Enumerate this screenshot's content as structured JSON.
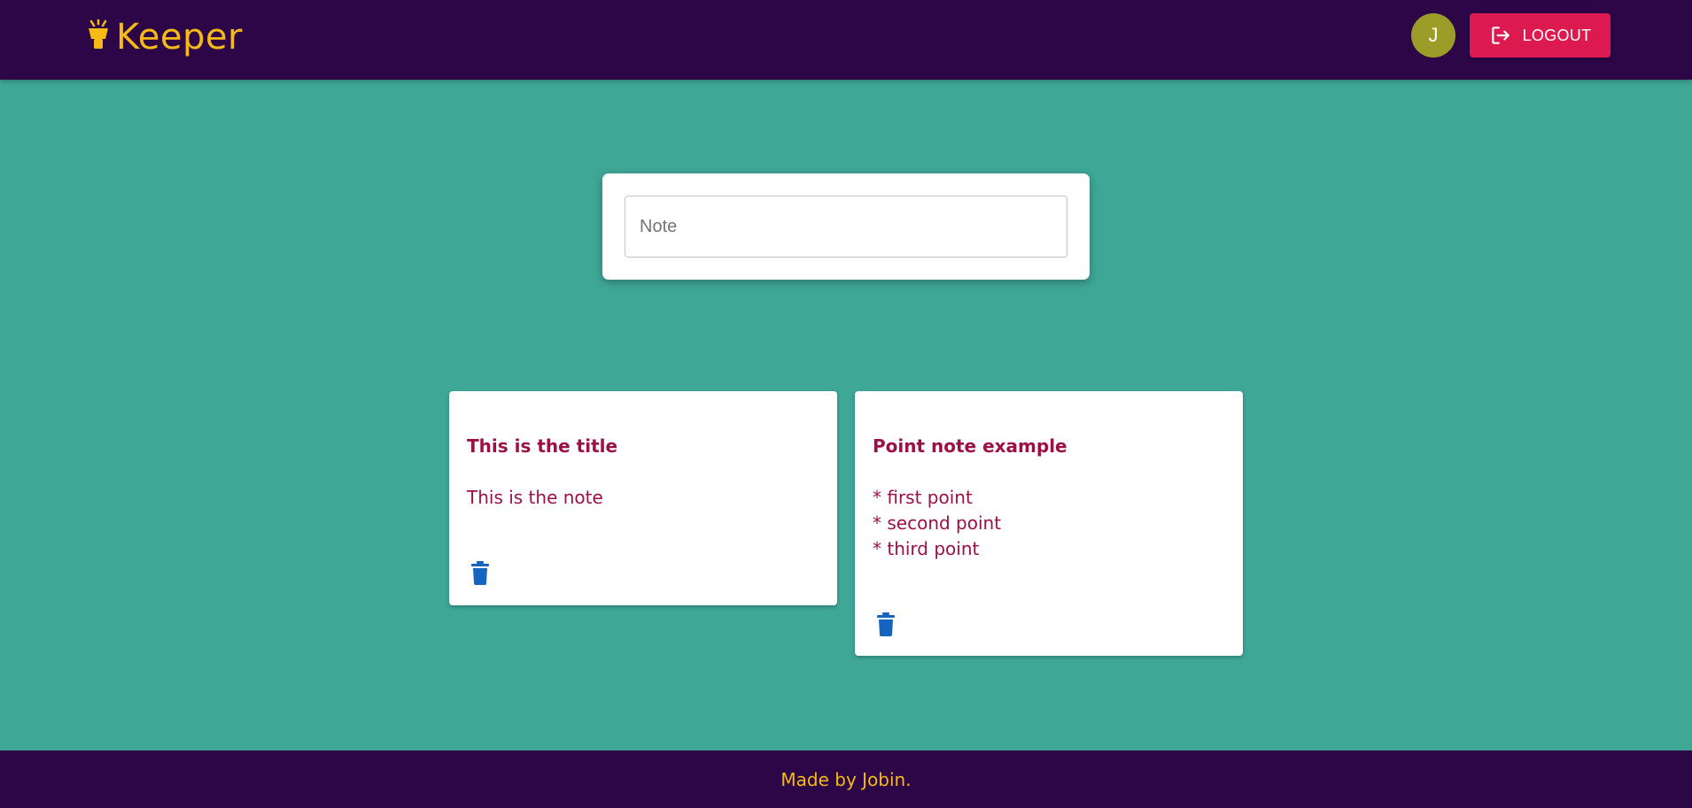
{
  "header": {
    "brand": {
      "name": "Keeper",
      "icon": "lightbulb-icon"
    },
    "avatar": {
      "initial": "J"
    },
    "logout": {
      "label": "LOGOUT",
      "icon": "logout-icon"
    }
  },
  "create_note": {
    "placeholder": "Note",
    "value": ""
  },
  "notes": [
    {
      "title": "This is the title",
      "lines": [
        "This is the note"
      ],
      "delete_icon": "trash-icon"
    },
    {
      "title": "Point note example",
      "lines": [
        "* first point",
        "* second point",
        "* third point"
      ],
      "delete_icon": "trash-icon"
    }
  ],
  "footer": {
    "text": "Made by Jobin."
  },
  "colors": {
    "header_bg": "#2c0646",
    "page_bg": "#3fa796",
    "brand": "#f5ba13",
    "note_text": "#9e1043",
    "logout_bg": "#dc1a4f",
    "avatar_bg": "#9c9c28",
    "delete_icon": "#1565c0"
  }
}
